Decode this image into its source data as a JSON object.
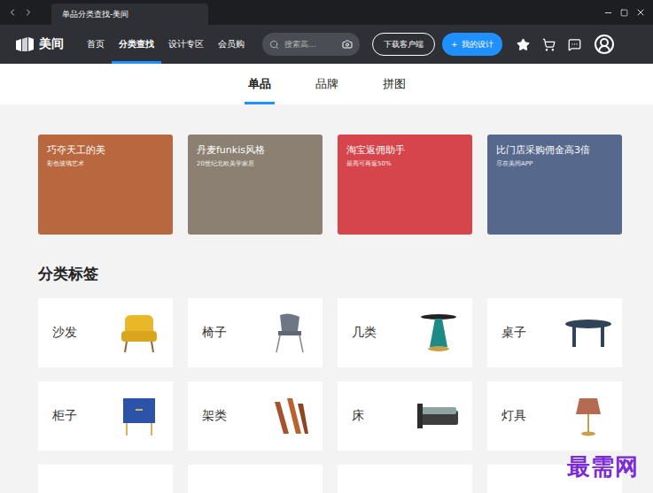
{
  "window": {
    "title": "单品分类查找-美间"
  },
  "nav": {
    "logo": "美间",
    "items": [
      {
        "label": "首页",
        "selected": false
      },
      {
        "label": "分类查找",
        "selected": true
      },
      {
        "label": "设计专区",
        "selected": false
      },
      {
        "label": "会员购",
        "selected": false
      }
    ],
    "search": {
      "placeholder": "搜索高..."
    },
    "download_button": "下载客户端",
    "design_button": {
      "icon": "+",
      "label": "我的设计"
    }
  },
  "subtabs": [
    {
      "label": "单品",
      "selected": true
    },
    {
      "label": "品牌",
      "selected": false
    },
    {
      "label": "拼图",
      "selected": false
    }
  ],
  "banners": [
    {
      "title": "巧夺天工的美",
      "subtitle": "彩色玻璃艺术",
      "color": "#b8673f"
    },
    {
      "title": "丹麦funkis风格",
      "subtitle": "20世纪北欧美学家居",
      "color": "#8c8072"
    },
    {
      "title": "淘宝返佣助手",
      "subtitle": "最高可再返50%",
      "color": "#d5454b"
    },
    {
      "title": "比门店采购佣金高3倍",
      "subtitle": "尽在美间APP",
      "color": "#56688c"
    }
  ],
  "section_title": "分类标签",
  "categories": [
    {
      "label": "沙发"
    },
    {
      "label": "椅子"
    },
    {
      "label": "几类"
    },
    {
      "label": "桌子"
    },
    {
      "label": "柜子"
    },
    {
      "label": "架类"
    },
    {
      "label": "床"
    },
    {
      "label": "灯具"
    },
    {
      "label": ""
    },
    {
      "label": ""
    },
    {
      "label": ""
    },
    {
      "label": ""
    }
  ],
  "watermark": "最需网"
}
